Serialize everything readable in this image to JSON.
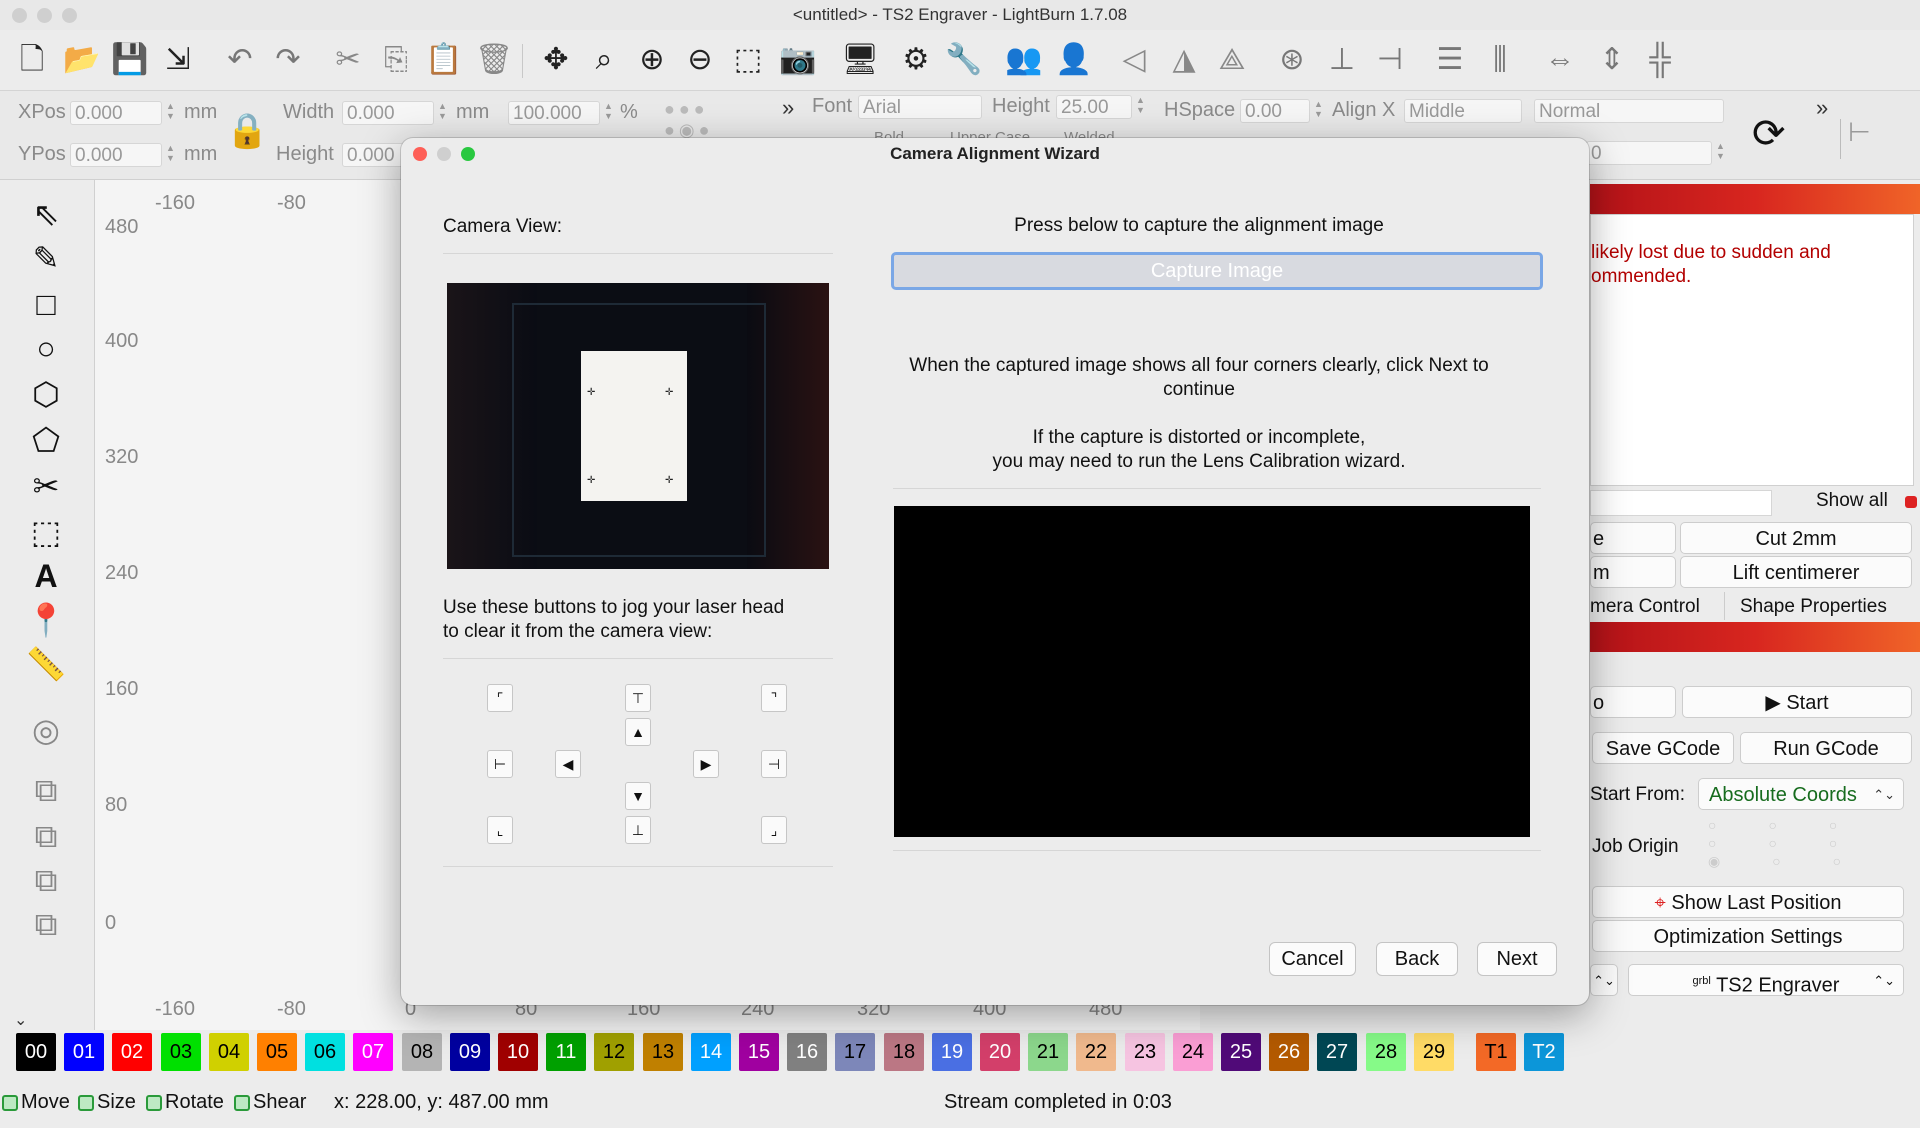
{
  "window": {
    "title": "<untitled> - TS2 Engraver - LightBurn 1.7.08"
  },
  "props": {
    "xpos_label": "XPos",
    "xpos_value": "0.000",
    "ypos_label": "YPos",
    "ypos_value": "0.000",
    "unit_mm": "mm",
    "width_label": "Width",
    "width_value": "0.000",
    "height_label": "Height",
    "height_value": "0.000",
    "scale_value": "100.000",
    "percent": "%",
    "font_label": "Font",
    "font_value": "Arial",
    "fheight_label": "Height",
    "fheight_value": "25.00",
    "hspace_label": "HSpace",
    "hspace_value": "0.00",
    "alignx_label": "Align X",
    "alignx_value": "Middle",
    "style_value": "Normal",
    "right_value": "0",
    "bold": "Bold",
    "upper": "Upper Case",
    "welded": "Welded"
  },
  "ruler": {
    "top": [
      "-160",
      "-80"
    ],
    "bottom": [
      "-160",
      "-80",
      "0",
      "80",
      "160",
      "240",
      "320",
      "400",
      "480"
    ],
    "left": [
      "480",
      "400",
      "320",
      "240",
      "160",
      "80",
      "0"
    ]
  },
  "right": {
    "warning": "likely lost due to sudden and\nommended.",
    "show_all": "Show all",
    "btn_e": "e",
    "cut2mm": "Cut 2mm",
    "btn_m": "m",
    "lift": "Lift centimerer",
    "camera_tab": "mera Control",
    "shape_tab": "Shape Properties",
    "btn_o": "o",
    "start": "Start",
    "save_gcode": "Save GCode",
    "run_gcode": "Run GCode",
    "start_from_label": "Start From:",
    "start_from_value": "Absolute Coords",
    "job_origin": "Job Origin",
    "show_last": "Show Last Position",
    "optimization": "Optimization Settings",
    "device_prefix": "grbl",
    "device": "TS2 Engraver"
  },
  "dialog": {
    "title": "Camera Alignment Wizard",
    "camera_view": "Camera View:",
    "capture_prompt": "Press below to capture the alignment image",
    "capture_button": "Capture Image",
    "info1_a": "When the captured image shows all four corners clearly, click Next to",
    "info1_b": "continue",
    "info2_a": "If the capture is distorted or incomplete,",
    "info2_b": "you may need to run the Lens Calibration wizard.",
    "jog_a": "Use these buttons to jog your laser head",
    "jog_b": "to clear it from the camera view:",
    "cancel": "Cancel",
    "back": "Back",
    "next": "Next"
  },
  "palette": [
    {
      "label": "00",
      "color": "#000000",
      "text": "#ffffff"
    },
    {
      "label": "01",
      "color": "#0000ff",
      "text": "#ffffff"
    },
    {
      "label": "02",
      "color": "#ff0000",
      "text": "#ffffff"
    },
    {
      "label": "03",
      "color": "#00e000",
      "text": "#000000"
    },
    {
      "label": "04",
      "color": "#d0d000",
      "text": "#000000"
    },
    {
      "label": "05",
      "color": "#ff8000",
      "text": "#000000"
    },
    {
      "label": "06",
      "color": "#00e0e0",
      "text": "#000000"
    },
    {
      "label": "07",
      "color": "#ff00ff",
      "text": "#ffffff"
    },
    {
      "label": "08",
      "color": "#b4b4b4",
      "text": "#000000"
    },
    {
      "label": "09",
      "color": "#0000a0",
      "text": "#ffffff"
    },
    {
      "label": "10",
      "color": "#a00000",
      "text": "#ffffff"
    },
    {
      "label": "11",
      "color": "#00a000",
      "text": "#ffffff"
    },
    {
      "label": "12",
      "color": "#a0a000",
      "text": "#000000"
    },
    {
      "label": "13",
      "color": "#c08000",
      "text": "#000000"
    },
    {
      "label": "14",
      "color": "#00a0ff",
      "text": "#ffffff"
    },
    {
      "label": "15",
      "color": "#a000a0",
      "text": "#ffffff"
    },
    {
      "label": "16",
      "color": "#808080",
      "text": "#ffffff"
    },
    {
      "label": "17",
      "color": "#7d87b9",
      "text": "#000000"
    },
    {
      "label": "18",
      "color": "#bb7784",
      "text": "#000000"
    },
    {
      "label": "19",
      "color": "#4a6fe3",
      "text": "#ffffff"
    },
    {
      "label": "20",
      "color": "#d33f6a",
      "text": "#ffffff"
    },
    {
      "label": "21",
      "color": "#8cd78c",
      "text": "#000000"
    },
    {
      "label": "22",
      "color": "#f0b98d",
      "text": "#000000"
    },
    {
      "label": "23",
      "color": "#f6c4e1",
      "text": "#000000"
    },
    {
      "label": "24",
      "color": "#fa9ed4",
      "text": "#000000"
    },
    {
      "label": "25",
      "color": "#500a78",
      "text": "#ffffff"
    },
    {
      "label": "26",
      "color": "#b45a00",
      "text": "#ffffff"
    },
    {
      "label": "27",
      "color": "#004754",
      "text": "#ffffff"
    },
    {
      "label": "28",
      "color": "#86fa88",
      "text": "#000000"
    },
    {
      "label": "29",
      "color": "#ffdb66",
      "text": "#000000"
    },
    {
      "label": "T1",
      "color": "#f36926",
      "text": "#000000"
    },
    {
      "label": "T2",
      "color": "#0c96d9",
      "text": "#ffffff"
    }
  ],
  "status": {
    "move": "Move",
    "size": "Size",
    "rotate": "Rotate",
    "shear": "Shear",
    "coords": "x: 228.00, y: 487.00 mm",
    "message": "Stream completed in 0:03"
  }
}
